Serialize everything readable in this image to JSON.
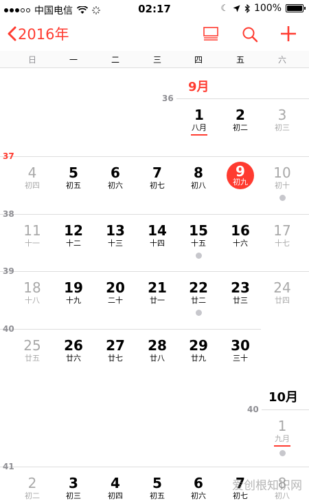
{
  "status": {
    "carrier": "中国电信",
    "time": "02:17",
    "battery": "100%",
    "battery_fraction": 1.0
  },
  "nav": {
    "back_label": "2016年"
  },
  "weekdays": [
    "日",
    "一",
    "二",
    "三",
    "四",
    "五",
    "六"
  ],
  "months": {
    "sep": "9月",
    "oct": "10月"
  },
  "weeks": {
    "w36": "36",
    "w37": "37",
    "w38": "38",
    "w39": "39",
    "w40a": "40",
    "w40b": "40",
    "w41": "41"
  },
  "days": {
    "sep1": {
      "d": "1",
      "l": "八月"
    },
    "sep2": {
      "d": "2",
      "l": "初二"
    },
    "sep3": {
      "d": "3",
      "l": "初三"
    },
    "sep4": {
      "d": "4",
      "l": "初四"
    },
    "sep5": {
      "d": "5",
      "l": "初五"
    },
    "sep6": {
      "d": "6",
      "l": "初六"
    },
    "sep7": {
      "d": "7",
      "l": "初七"
    },
    "sep8": {
      "d": "8",
      "l": "初八"
    },
    "sep9": {
      "d": "9",
      "l": "初九"
    },
    "sep10": {
      "d": "10",
      "l": "初十"
    },
    "sep11": {
      "d": "11",
      "l": "十一"
    },
    "sep12": {
      "d": "12",
      "l": "十二"
    },
    "sep13": {
      "d": "13",
      "l": "十三"
    },
    "sep14": {
      "d": "14",
      "l": "十四"
    },
    "sep15": {
      "d": "15",
      "l": "十五"
    },
    "sep16": {
      "d": "16",
      "l": "十六"
    },
    "sep17": {
      "d": "17",
      "l": "十七"
    },
    "sep18": {
      "d": "18",
      "l": "十八"
    },
    "sep19": {
      "d": "19",
      "l": "十九"
    },
    "sep20": {
      "d": "20",
      "l": "二十"
    },
    "sep21": {
      "d": "21",
      "l": "廿一"
    },
    "sep22": {
      "d": "22",
      "l": "廿二"
    },
    "sep23": {
      "d": "23",
      "l": "廿三"
    },
    "sep24": {
      "d": "24",
      "l": "廿四"
    },
    "sep25": {
      "d": "25",
      "l": "廿五"
    },
    "sep26": {
      "d": "26",
      "l": "廿六"
    },
    "sep27": {
      "d": "27",
      "l": "廿七"
    },
    "sep28": {
      "d": "28",
      "l": "廿八"
    },
    "sep29": {
      "d": "29",
      "l": "廿九"
    },
    "sep30": {
      "d": "30",
      "l": "三十"
    },
    "oct1": {
      "d": "1",
      "l": "九月"
    },
    "oct2": {
      "d": "2",
      "l": "初二"
    },
    "oct3": {
      "d": "3",
      "l": "初三"
    },
    "oct4": {
      "d": "4",
      "l": "初四"
    },
    "oct5": {
      "d": "5",
      "l": "初五"
    },
    "oct6": {
      "d": "6",
      "l": "初六"
    },
    "oct7": {
      "d": "7",
      "l": "初七"
    },
    "oct8": {
      "d": "8",
      "l": "初八"
    }
  },
  "watermark": "爱创根知识网",
  "colors": {
    "accent": "#ff3b30",
    "weekend": "#a8a8a8"
  }
}
